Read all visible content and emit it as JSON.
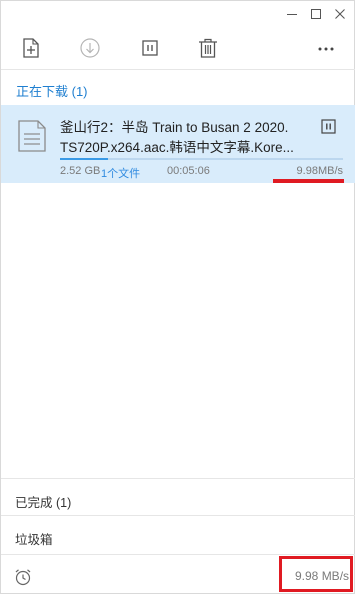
{
  "window": {
    "controls": [
      "minimize-icon",
      "maximize-icon",
      "close-icon"
    ]
  },
  "toolbar": {
    "tools": [
      "new-task-icon",
      "download-icon",
      "pause-icon",
      "delete-icon",
      "more-icon"
    ],
    "more_label": "···"
  },
  "downloading": {
    "title": "正在下载 (1)",
    "task": {
      "name_line1": "釜山行2：半岛 Train to Busan 2 2020.",
      "name_line2": "TS720P.x264.aac.韩语中文字幕.Kore...",
      "size": "2.52 GB",
      "files": "1个文件",
      "elapsed": "00:05:06",
      "speed": "9.98MB/s",
      "progress": 0.17,
      "icon": "file-icon",
      "pause_icon": "pause-icon"
    }
  },
  "categories": {
    "completed": "已完成 (1)",
    "trash": "垃圾箱"
  },
  "footer": {
    "icon": "alarm-clock-icon",
    "total_speed": "9.98 MB/s"
  },
  "colors": {
    "accent": "#1f7fd0",
    "selected_row": "#d9ecfb",
    "highlight": "#e01a22"
  }
}
